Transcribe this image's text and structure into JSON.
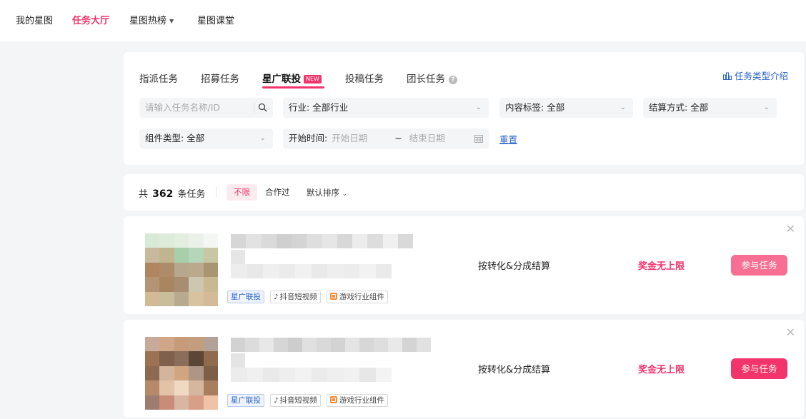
{
  "nav": {
    "items": [
      {
        "label": "我的星图"
      },
      {
        "label": "任务大厅"
      },
      {
        "label": "星图热榜"
      },
      {
        "label": "星图课堂"
      }
    ]
  },
  "filters": {
    "tabs": [
      {
        "label": "指派任务"
      },
      {
        "label": "招募任务"
      },
      {
        "label": "星广联投",
        "badge": "NEW"
      },
      {
        "label": "投稿任务"
      },
      {
        "label": "团长任务"
      }
    ],
    "intro_link": "任务类型介绍",
    "search_placeholder": "请输入任务名称/ID",
    "industry": {
      "label": "行业:",
      "value": "全部行业"
    },
    "content_tag": {
      "label": "内容标签:",
      "value": "全部"
    },
    "settlement": {
      "label": "结算方式:",
      "value": "全部"
    },
    "component_type": {
      "label": "组件类型:",
      "value": "全部"
    },
    "start_time": {
      "label": "开始时间:",
      "start_placeholder": "开始日期",
      "separator": "~",
      "end_placeholder": "结束日期"
    },
    "reset": "重置"
  },
  "summary": {
    "prefix": "共",
    "count": "362",
    "suffix": "条任务",
    "chips": [
      "不限",
      "合作过"
    ],
    "sort": "默认排序"
  },
  "tasks": [
    {
      "tags": [
        "星广联投",
        "抖音短视频",
        "游戏行业组件"
      ],
      "settlement": "按转化&分成结算",
      "reward": "奖金无上限",
      "button": "参与任务"
    },
    {
      "tags": [
        "星广联投",
        "抖音短视频",
        "游戏行业组件"
      ],
      "settlement": "按转化&分成结算",
      "reward": "奖金无上限",
      "button": "参与任务"
    }
  ],
  "colors": {
    "accent": "#f3336b",
    "link": "#2a63c9",
    "background": "#f4f5f7"
  }
}
